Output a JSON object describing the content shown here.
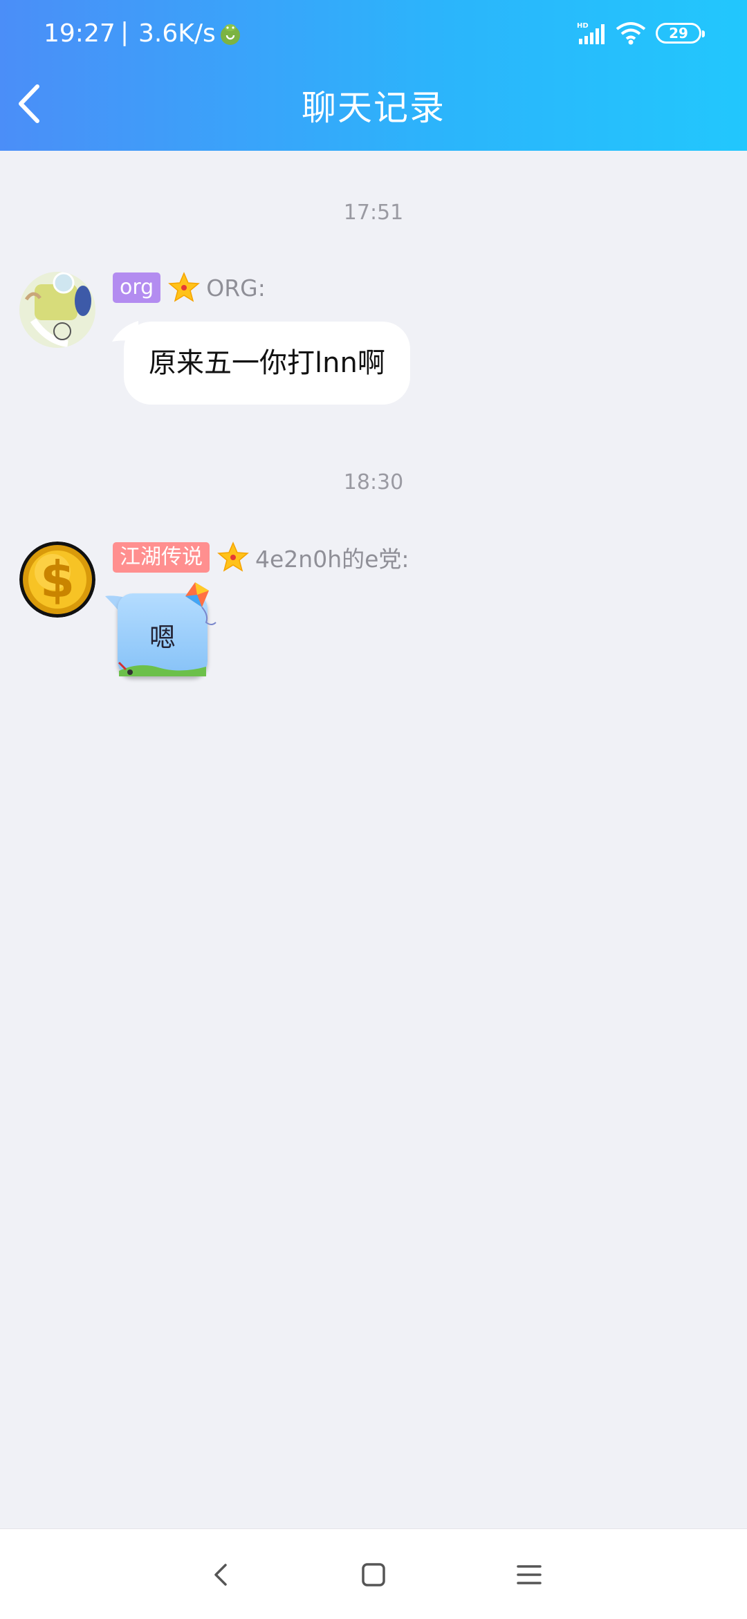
{
  "status_bar": {
    "time": "19:27",
    "separator": "|",
    "net_speed": "3.6K/s",
    "network_badge": "HD",
    "battery_level": "29"
  },
  "header": {
    "title": "聊天记录",
    "back_icon": "chevron-left-icon"
  },
  "messages": [
    {
      "timestamp": "17:51",
      "badge": "org",
      "badge_color": "#b38cf0",
      "sender": "ORG:",
      "text": "原来五一你打lnn啊"
    },
    {
      "timestamp": "18:30",
      "badge": "江湖传说",
      "badge_color": "#ff8f8f",
      "sender": "4e2n0h的e党:",
      "text": "嗯"
    }
  ],
  "nav_bar": {
    "back_icon": "nav-back-icon",
    "home_icon": "nav-home-icon",
    "menu_icon": "nav-menu-icon"
  },
  "colors": {
    "header_start": "#4b8ef8",
    "header_end": "#22c7fd",
    "background": "#f0f1f6"
  }
}
